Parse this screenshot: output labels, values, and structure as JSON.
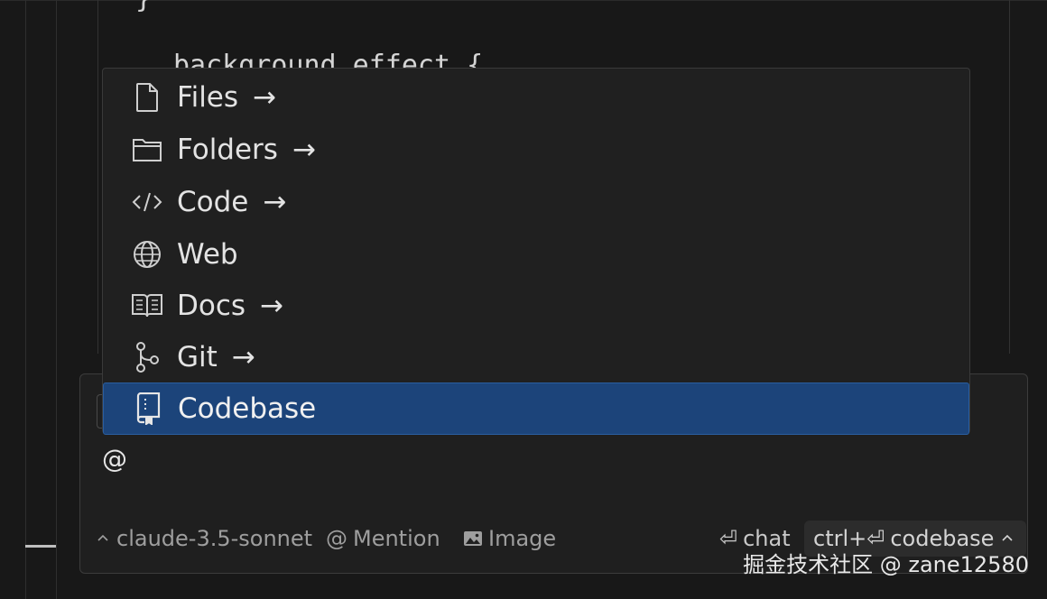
{
  "editor": {
    "code_line_top": "}",
    "code_line_partial": "background_effect {"
  },
  "menu": {
    "items": [
      {
        "label": "Files",
        "icon": "file-icon",
        "has_arrow": true,
        "arrow": "→"
      },
      {
        "label": "Folders",
        "icon": "folder-icon",
        "has_arrow": true,
        "arrow": "→"
      },
      {
        "label": "Code",
        "icon": "code-icon",
        "has_arrow": true,
        "arrow": "→"
      },
      {
        "label": "Web",
        "icon": "globe-icon",
        "has_arrow": false,
        "arrow": ""
      },
      {
        "label": "Docs",
        "icon": "book-icon",
        "has_arrow": true,
        "arrow": "→"
      },
      {
        "label": "Git",
        "icon": "git-branch-icon",
        "has_arrow": true,
        "arrow": "→"
      },
      {
        "label": "Codebase",
        "icon": "repo-icon",
        "has_arrow": false,
        "arrow": "",
        "selected": true
      }
    ]
  },
  "chat": {
    "input_value": "@",
    "model_chevron": "^",
    "model": "claude-3.5-sonnet",
    "mention_symbol": "@",
    "mention_label": "Mention",
    "image_label": "Image",
    "chat_key": "⏎",
    "chat_label": "chat",
    "codebase_key": "ctrl+⏎",
    "codebase_label": "codebase",
    "codebase_chevron": "^"
  },
  "watermark": "掘金技术社区 @ zane12580",
  "colors": {
    "background": "#181818",
    "menu_bg": "#202020",
    "selected_bg": "#1c447a",
    "text": "#e3e3e3",
    "muted": "#9e9e9e"
  }
}
